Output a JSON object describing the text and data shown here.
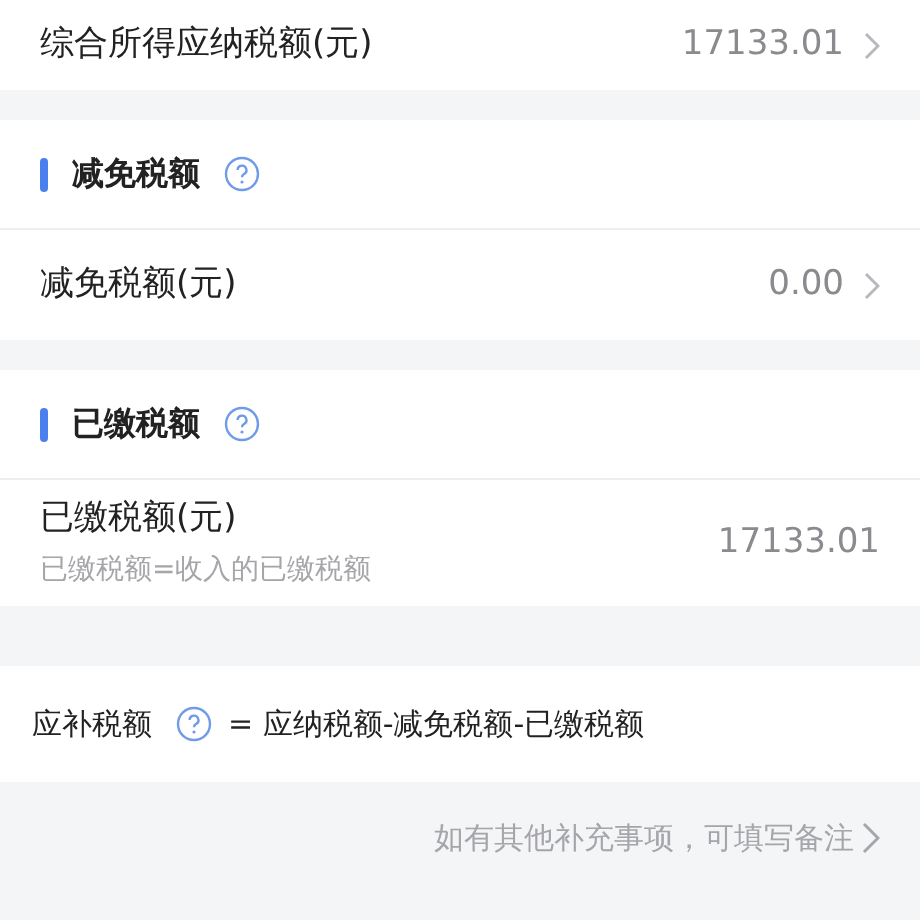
{
  "summary_row": {
    "label": "综合所得应纳税额(元)",
    "value": "17133.01",
    "navigable": true
  },
  "sections": [
    {
      "title": "减免税额",
      "rows": [
        {
          "label": "减免税额(元)",
          "value": "0.00",
          "navigable": true
        }
      ]
    },
    {
      "title": "已缴税额",
      "rows": [
        {
          "label": "已缴税额(元)",
          "note": "已缴税额=收入的已缴税额",
          "value": "17133.01",
          "navigable": false
        }
      ]
    }
  ],
  "formula": {
    "label": "应补税额",
    "expression": "= 应纳税额-减免税额-已缴税额"
  },
  "remark_link": "如有其他补充事项，可填写备注"
}
